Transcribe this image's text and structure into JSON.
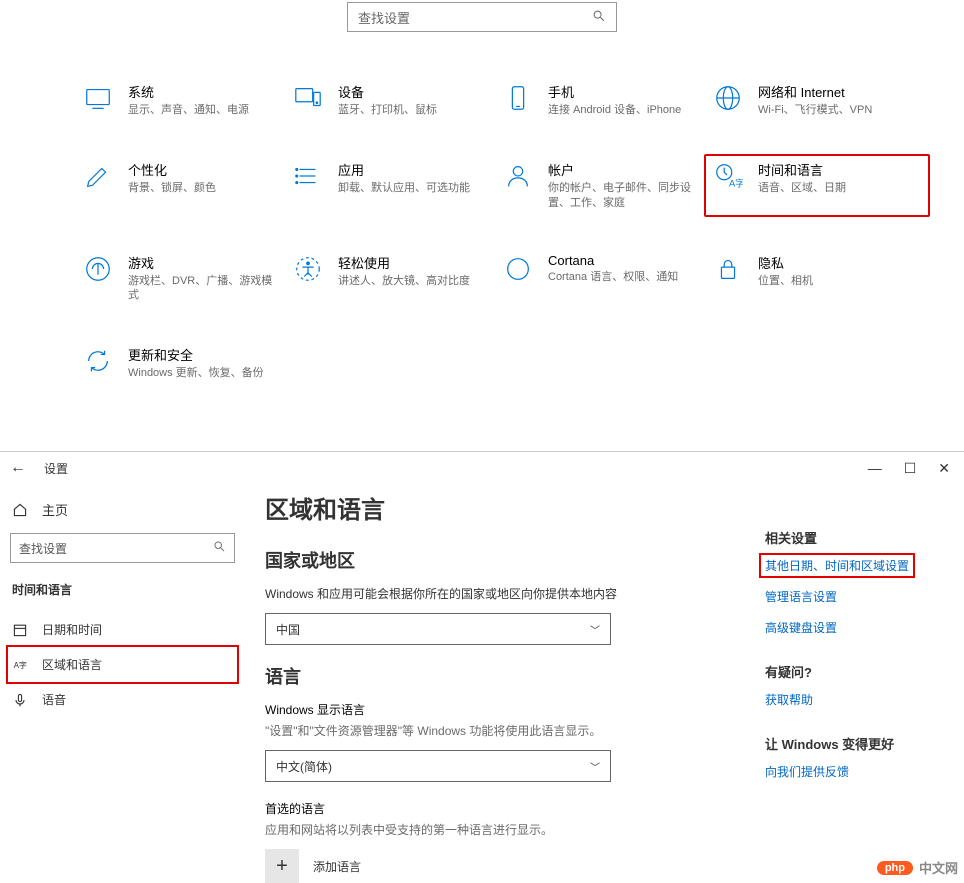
{
  "top": {
    "search_placeholder": "查找设置",
    "tiles": [
      {
        "title": "系统",
        "desc": "显示、声音、通知、电源"
      },
      {
        "title": "设备",
        "desc": "蓝牙、打印机、鼠标"
      },
      {
        "title": "手机",
        "desc": "连接 Android 设备、iPhone"
      },
      {
        "title": "网络和 Internet",
        "desc": "Wi-Fi、飞行模式、VPN"
      },
      {
        "title": "个性化",
        "desc": "背景、锁屏、颜色"
      },
      {
        "title": "应用",
        "desc": "卸载、默认应用、可选功能"
      },
      {
        "title": "帐户",
        "desc": "你的帐户、电子邮件、同步设置、工作、家庭"
      },
      {
        "title": "时间和语言",
        "desc": "语音、区域、日期"
      },
      {
        "title": "游戏",
        "desc": "游戏栏、DVR、广播、游戏模式"
      },
      {
        "title": "轻松使用",
        "desc": "讲述人、放大镜、高对比度"
      },
      {
        "title": "Cortana",
        "desc": "Cortana 语言、权限、通知"
      },
      {
        "title": "隐私",
        "desc": "位置、相机"
      },
      {
        "title": "更新和安全",
        "desc": "Windows 更新、恢复、备份"
      }
    ]
  },
  "bottom": {
    "window_title": "设置",
    "home_label": "主页",
    "search_placeholder": "查找设置",
    "section_title": "时间和语言",
    "sidebar": [
      {
        "label": "日期和时间"
      },
      {
        "label": "区域和语言"
      },
      {
        "label": "语音"
      }
    ],
    "page_title": "区域和语言",
    "country_heading": "国家或地区",
    "country_desc": "Windows 和应用可能会根据你所在的国家或地区向你提供本地内容",
    "country_value": "中国",
    "lang_heading": "语言",
    "display_lang_label": "Windows 显示语言",
    "display_lang_desc": "\"设置\"和\"文件资源管理器\"等 Windows 功能将使用此语言显示。",
    "display_lang_value": "中文(简体)",
    "pref_lang_label": "首选的语言",
    "pref_lang_desc": "应用和网站将以列表中受支持的第一种语言进行显示。",
    "add_lang_label": "添加语言",
    "related_heading": "相关设置",
    "related_links": [
      "其他日期、时间和区域设置",
      "管理语言设置",
      "高级键盘设置"
    ],
    "help_heading": "有疑问?",
    "help_link": "获取帮助",
    "feedback_heading": "让 Windows 变得更好",
    "feedback_link": "向我们提供反馈",
    "watermark": "中文网",
    "watermark_badge": "php"
  }
}
